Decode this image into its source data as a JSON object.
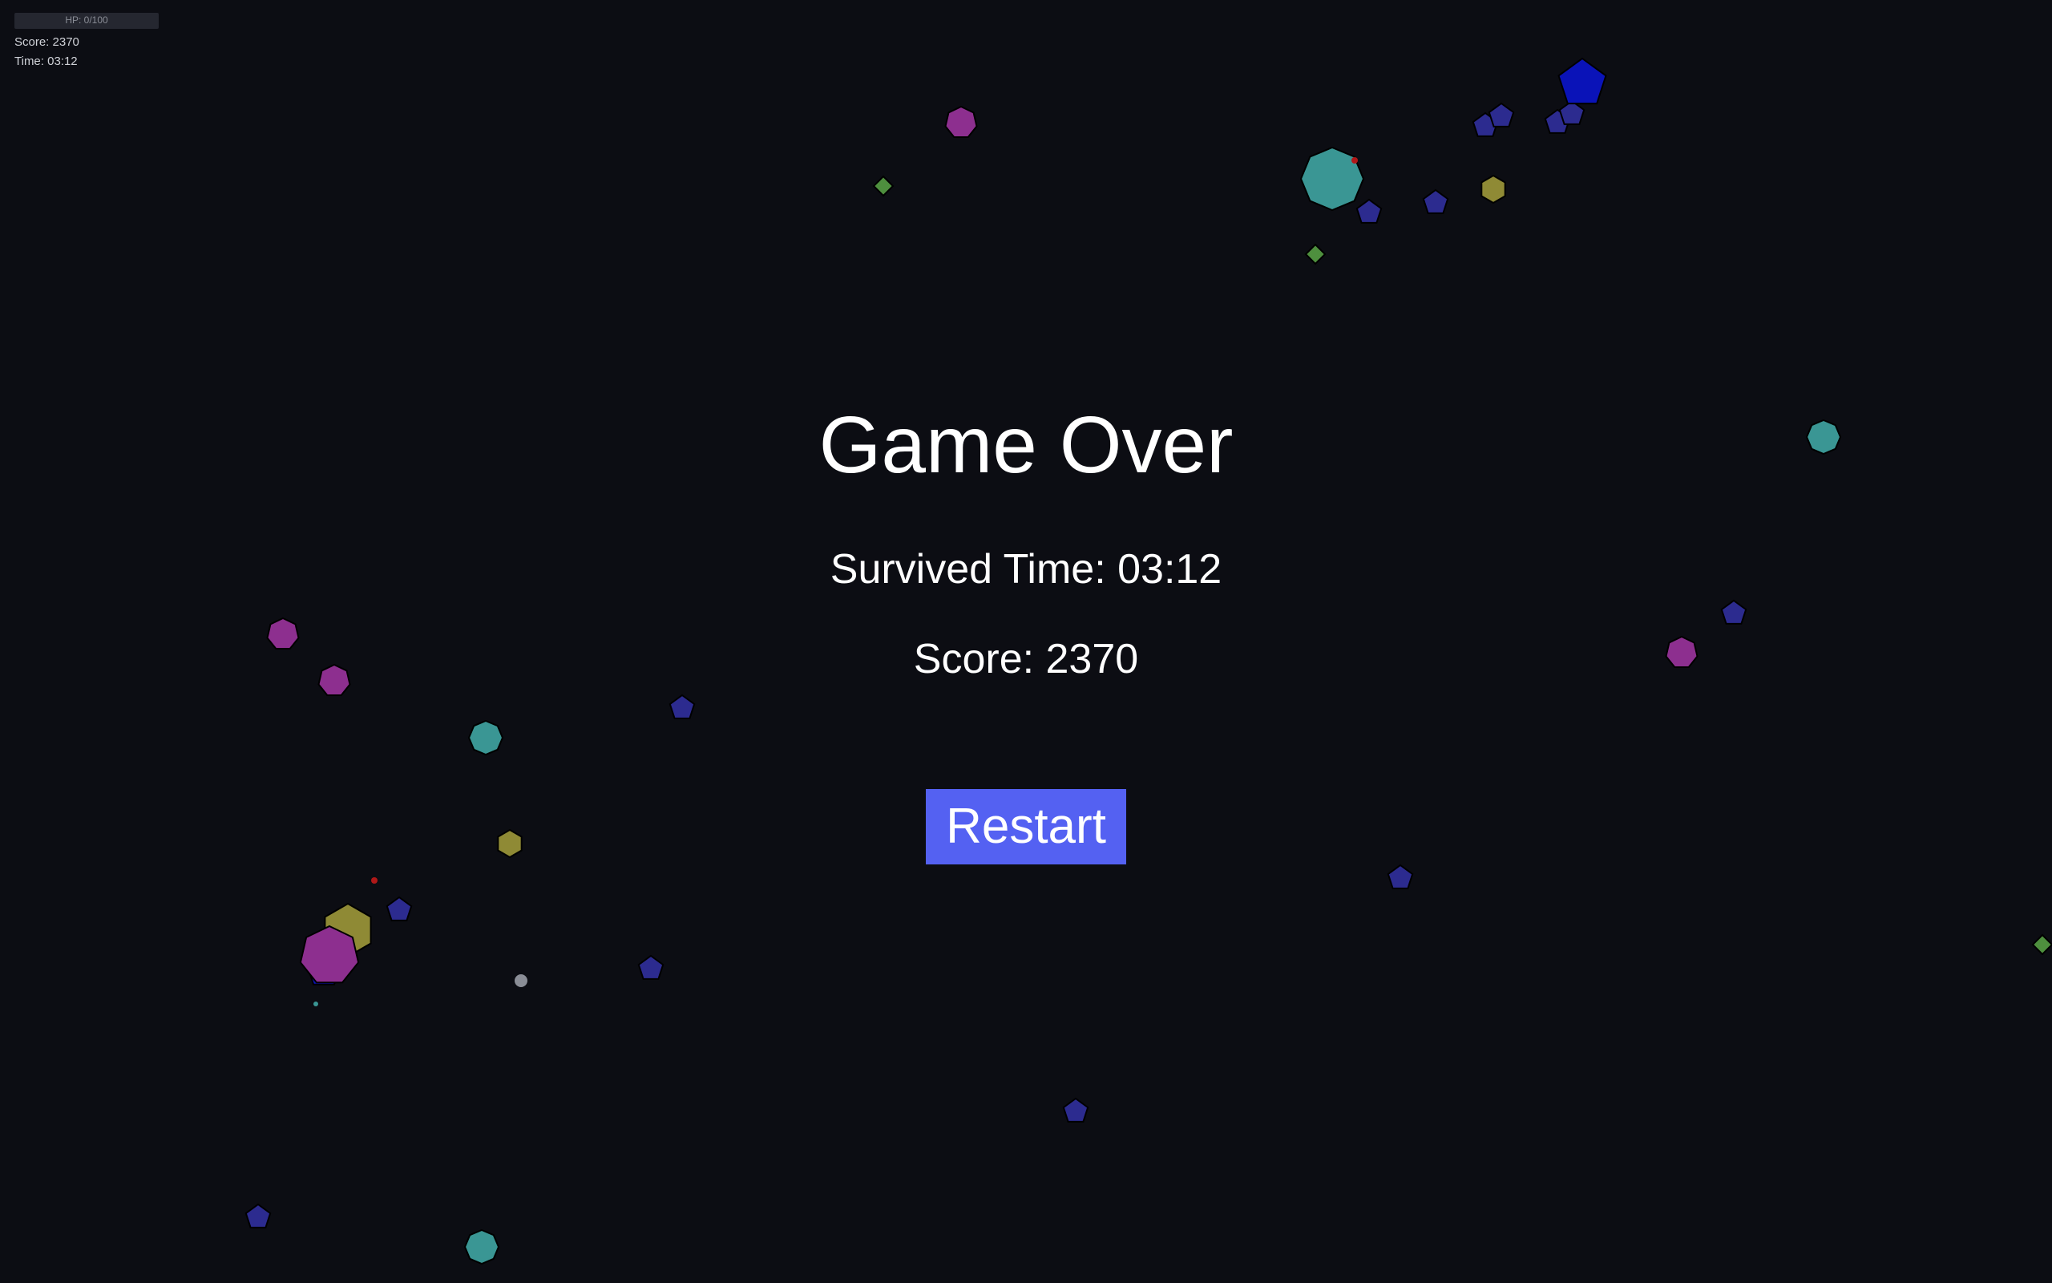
{
  "hud": {
    "hp_label": "HP: 0/100",
    "hp_fraction": 0,
    "score_label": "Score: 2370",
    "time_label": "Time: 03:12"
  },
  "game_over": {
    "title": "Game Over",
    "survived_time": "Survived Time: 03:12",
    "score": "Score: 2370",
    "restart_label": "Restart"
  },
  "colors": {
    "background": "#0c0d13",
    "restart_button": "#5461f2",
    "pentagon_enemy": "#2c2b8f",
    "large_pentagon_enemy": "#0a13b8",
    "heptagon_enemy": "#8d2f8f",
    "octagon_enemy": "#3a9694",
    "hexagon_enemy": "#8f8a35",
    "diamond_pickup": "#4e8f3e",
    "bullet": "#b01818"
  }
}
